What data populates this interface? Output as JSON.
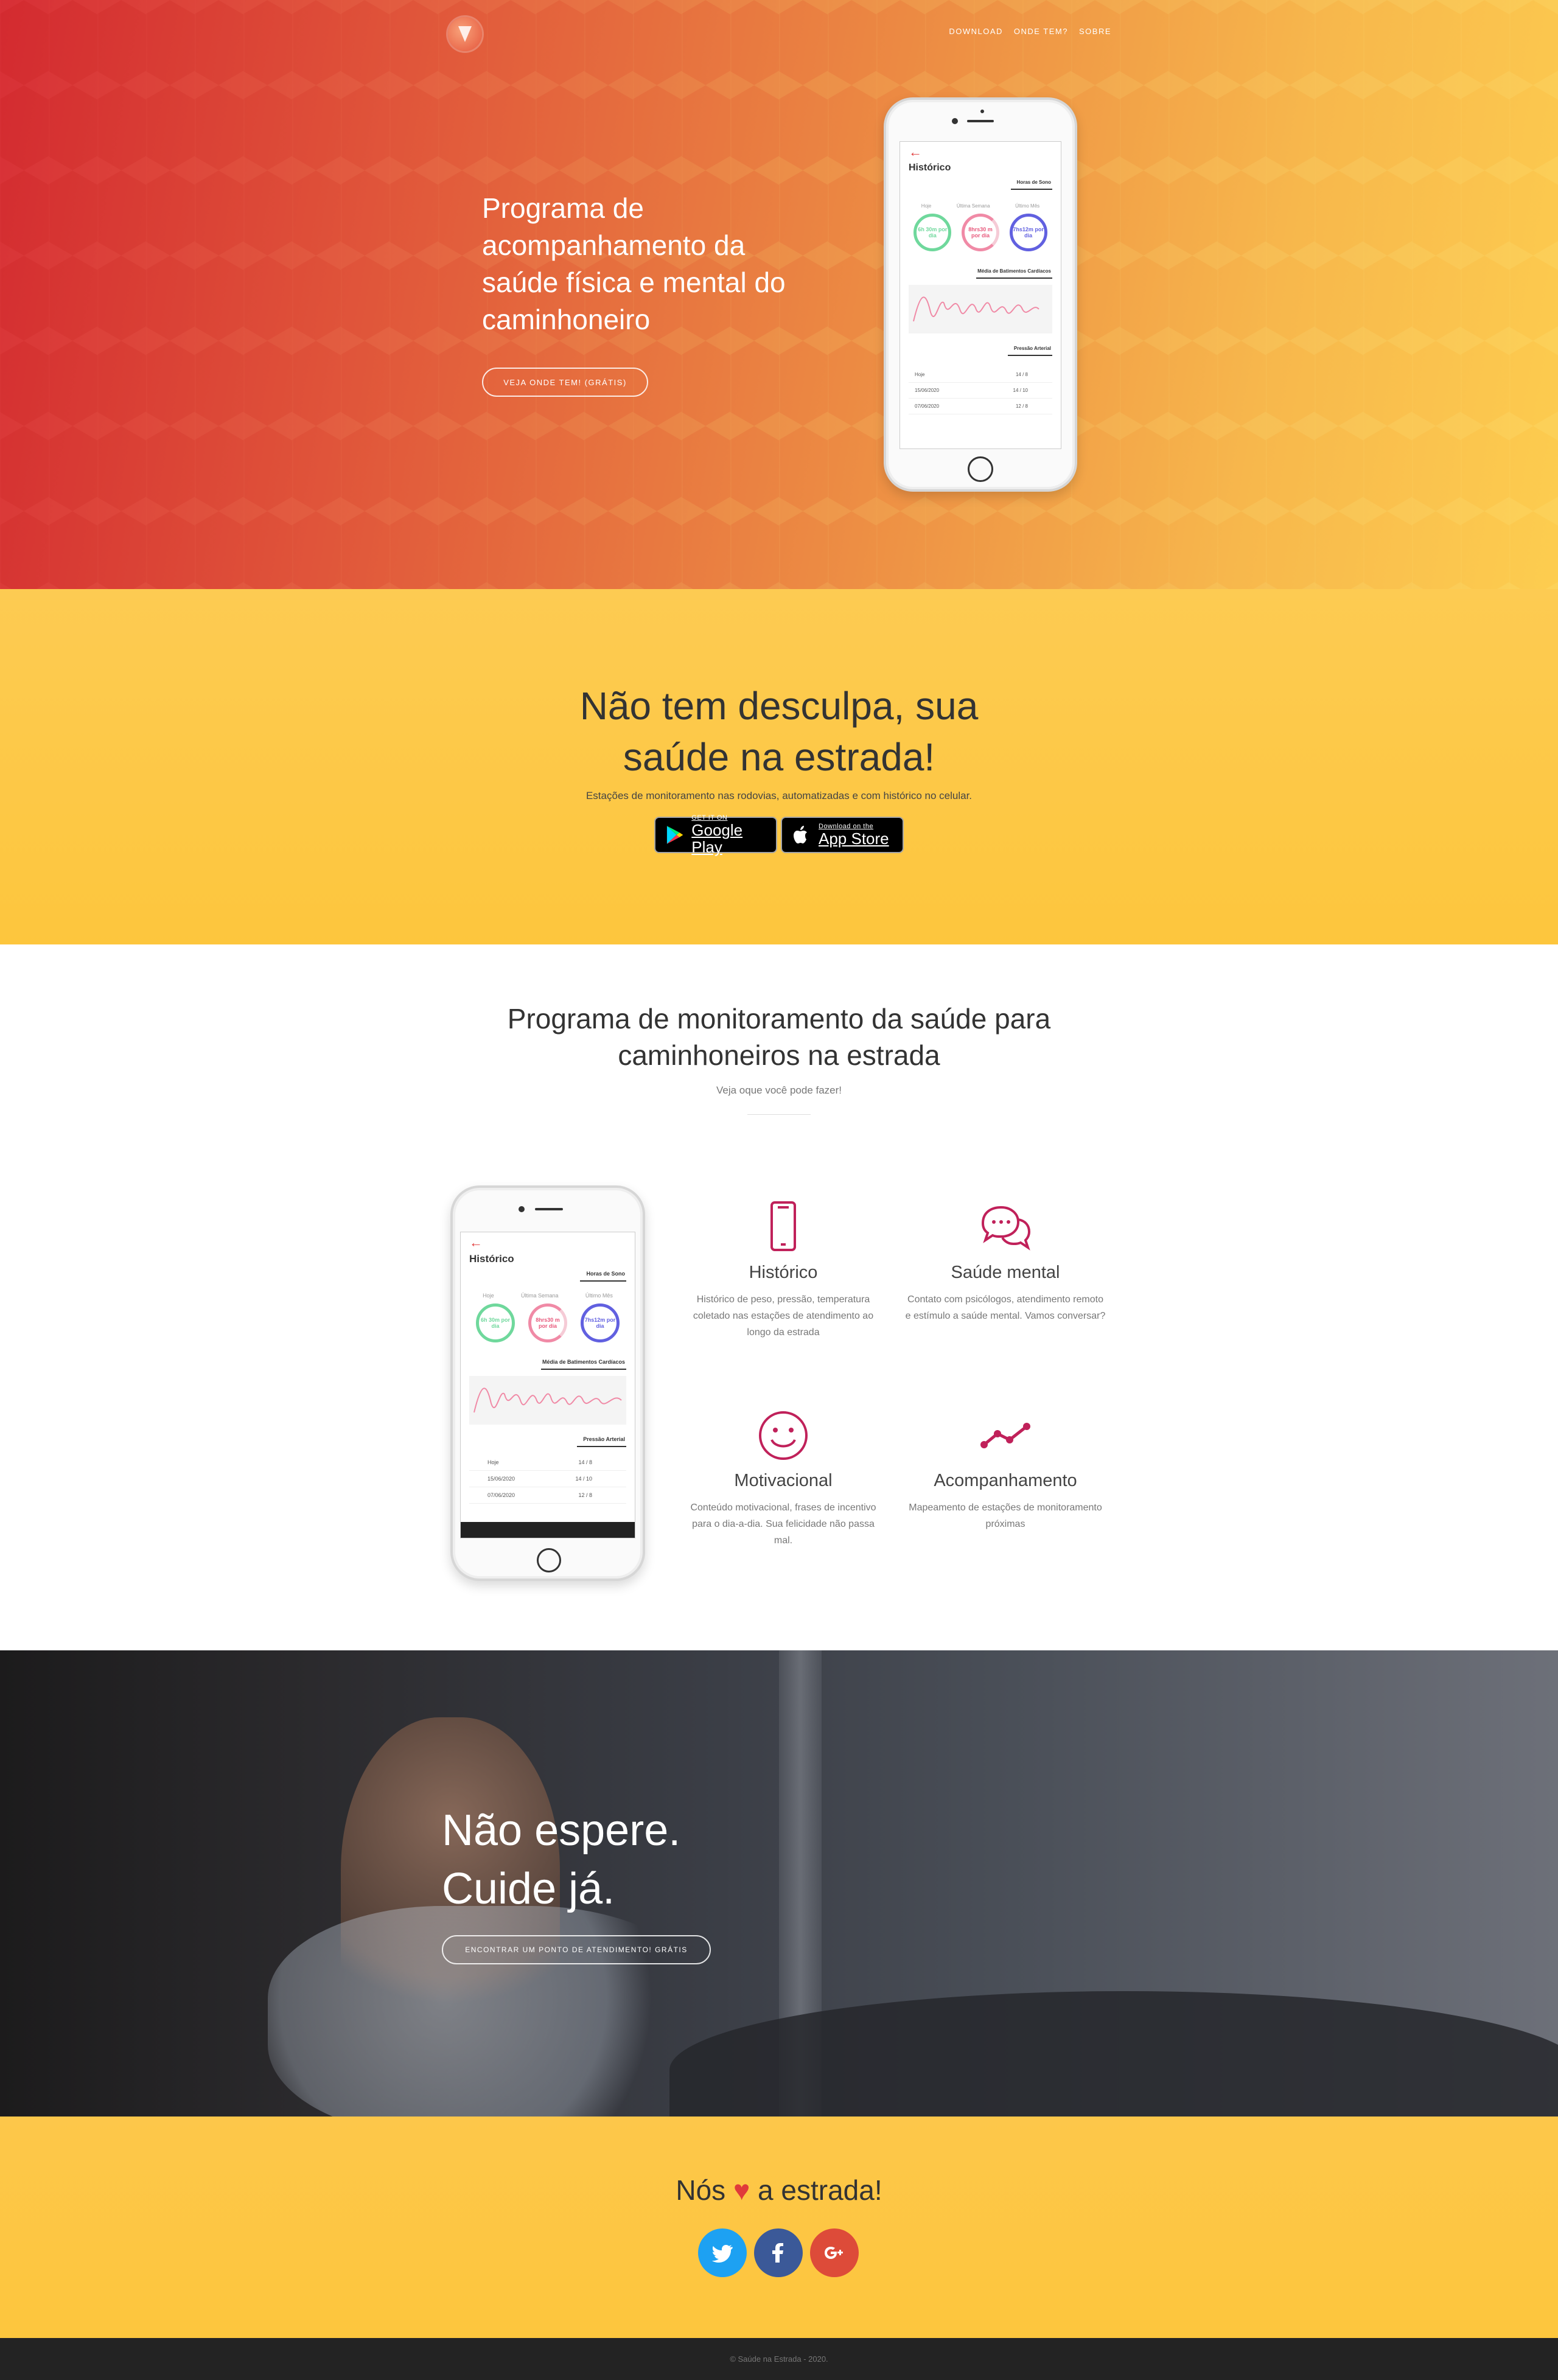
{
  "nav": {
    "links": [
      "Download",
      "Onde tem?",
      "Sobre"
    ]
  },
  "hero": {
    "title": "Programa de acompanhamento da saúde física e mental do caminhoneiro",
    "button": "Veja onde tem! (grátis)"
  },
  "phone_app": {
    "title": "Histórico",
    "sleep_section": "Horas de Sono",
    "periods": [
      "Hoje",
      "Última Semana",
      "Último Mês"
    ],
    "rings": [
      "6h 30m por dia",
      "8hrs30 m por dia",
      "7hs12m por dia"
    ],
    "heart_section": "Média de Batimentos Cardíacos",
    "pressure_section": "Pressão Arterial",
    "rows": [
      {
        "date": "Hoje",
        "value": "14 / 8"
      },
      {
        "date": "15/06/2020",
        "value": "14 / 10"
      },
      {
        "date": "07/06/2020",
        "value": "12 / 8"
      }
    ]
  },
  "download": {
    "title": "Não tem desculpa, sua saúde na estrada!",
    "subtitle": "Estações de monitoramento nas rodovias, automatizadas e com histórico no celular.",
    "google_play": {
      "line1": "GET IT ON",
      "line2": "Google Play"
    },
    "app_store": {
      "line1": "Download on the",
      "line2": "App Store"
    }
  },
  "features_section": {
    "title": "Programa de monitoramento da saúde para caminhoneiros na estrada",
    "subtitle": "Veja oque você pode fazer!",
    "items": [
      {
        "icon": "smartphone-icon",
        "name": "Histórico",
        "desc": "Histórico de peso, pressão, temperatura coletado nas estações de atendimento ao longo da estrada"
      },
      {
        "icon": "chat-bubbles-icon",
        "name": "Saúde mental",
        "desc": "Contato com psicólogos, atendimento remoto e estímulo a saúde mental. Vamos conversar?"
      },
      {
        "icon": "smiley-icon",
        "name": "Motivacional",
        "desc": "Conteúdo motivacional, frases de incentivo para o dia-a-dia. Sua felicidade não passa mal."
      },
      {
        "icon": "trend-line-icon",
        "name": "Acompanhamento",
        "desc": "Mapeamento de estações de monitoramento próximas"
      }
    ]
  },
  "cta": {
    "title_line1": "Não espere.",
    "title_line2": "Cuide já.",
    "button": "Encontrar um ponto de atendimento! Grátis"
  },
  "love": {
    "before": "Nós",
    "after": "a estrada!",
    "heart": "♥"
  },
  "social": [
    "twitter-icon",
    "facebook-icon",
    "google-plus-icon"
  ],
  "footer": {
    "text": "© Saúde na Estrada - 2020."
  },
  "colors": {
    "accent": "#c0215a",
    "yellow": "#fdc63d",
    "hero_red": "#d32a30",
    "twitter": "#1da1f2",
    "facebook": "#3b5998",
    "google": "#dd4b39"
  }
}
